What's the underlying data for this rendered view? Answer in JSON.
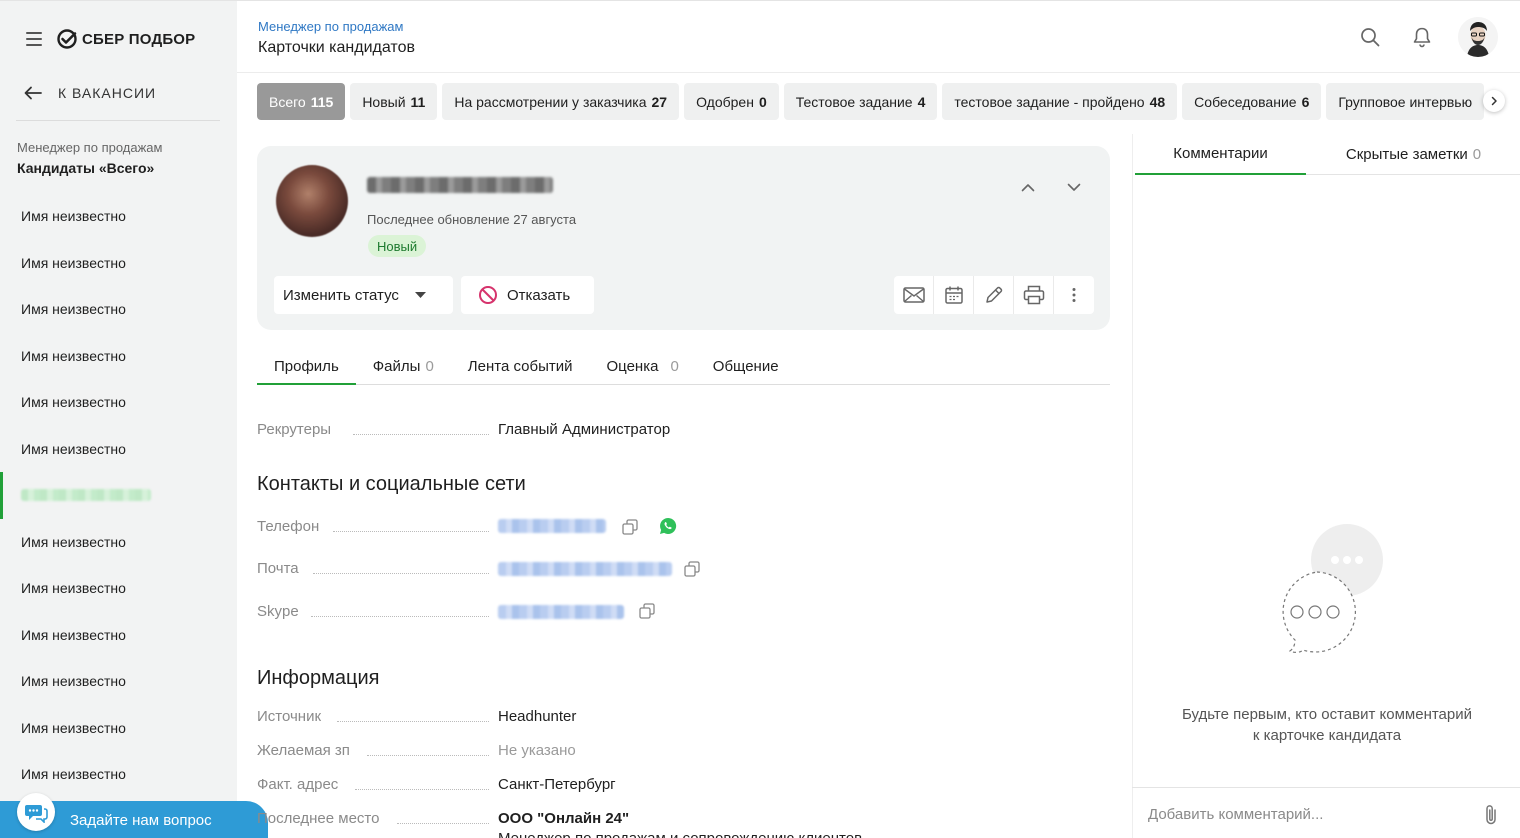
{
  "brand": {
    "name": "СБЕР ПОДБОР",
    "accent": "#21a038"
  },
  "sidebar": {
    "back_label": "К ВАКАНСИИ",
    "vacancy_subtitle": "Менеджер по продажам",
    "vacancy_title": "Кандидаты «Всего»",
    "candidates": [
      {
        "name": "Имя неизвестно"
      },
      {
        "name": "Имя неизвестно"
      },
      {
        "name": "Имя неизвестно"
      },
      {
        "name": "Имя неизвестно"
      },
      {
        "name": "Имя неизвестно"
      },
      {
        "name": "Имя неизвестно"
      },
      {
        "name": "",
        "active": true
      },
      {
        "name": "Имя неизвестно"
      },
      {
        "name": "Имя неизвестно"
      },
      {
        "name": "Имя неизвестно"
      },
      {
        "name": "Имя неизвестно"
      },
      {
        "name": "Имя неизвестно"
      },
      {
        "name": "Имя неизвестно"
      }
    ],
    "ask_label": "Задайте нам вопрос"
  },
  "header": {
    "breadcrumb": "Менеджер по продажам",
    "title": "Карточки кандидатов",
    "icons": [
      "search-icon",
      "bell-icon",
      "user-avatar"
    ]
  },
  "status_tabs": [
    {
      "label": "Всего",
      "count": "115",
      "active": true
    },
    {
      "label": "Новый",
      "count": "11"
    },
    {
      "label": "На рассмотрении у заказчика",
      "count": "27"
    },
    {
      "label": "Одобрен",
      "count": "0"
    },
    {
      "label": "Тестовое задание",
      "count": "4"
    },
    {
      "label": "тестовое задание - пройдено",
      "count": "48"
    },
    {
      "label": "Собеседование",
      "count": "6"
    },
    {
      "label": "Групповое интервью",
      "count": ""
    }
  ],
  "candidate_card": {
    "updated": "Последнее обновление 27 августа",
    "status_badge": "Новый",
    "change_status_label": "Изменить статус",
    "reject_label": "Отказать",
    "reject_color": "#d6336c"
  },
  "profile_tabs": [
    {
      "label": "Профиль",
      "count": "",
      "active": true
    },
    {
      "label": "Файлы",
      "count": "0"
    },
    {
      "label": "Лента событий",
      "count": ""
    },
    {
      "label": "Оценка",
      "count": "0"
    },
    {
      "label": "Общение",
      "count": ""
    }
  ],
  "profile": {
    "recruiters_label": "Рекрутеры",
    "recruiters_value": "Главный Администратор",
    "contacts_heading": "Контакты и социальные сети",
    "phone_label": "Телефон",
    "email_label": "Почта",
    "skype_label": "Skype",
    "info_heading": "Информация",
    "source_label": "Источник",
    "source_value": "Headhunter",
    "salary_label": "Желаемая зп",
    "salary_value": "Не указано",
    "address_label": "Факт. адрес",
    "address_value": "Санкт-Петербург",
    "last_place_label": "Последнее место",
    "last_place_value": "ООО \"Онлайн 24\"",
    "last_place_position": "Менеджер по продажам и сопровождению клиентов"
  },
  "comments": {
    "tab_comments": "Комментарии",
    "tab_notes": "Скрытые заметки",
    "notes_count": "0",
    "empty_line1": "Будьте первым, кто оставит комментарий",
    "empty_line2": "к карточке кандидата",
    "input_placeholder": "Добавить комментарий..."
  }
}
